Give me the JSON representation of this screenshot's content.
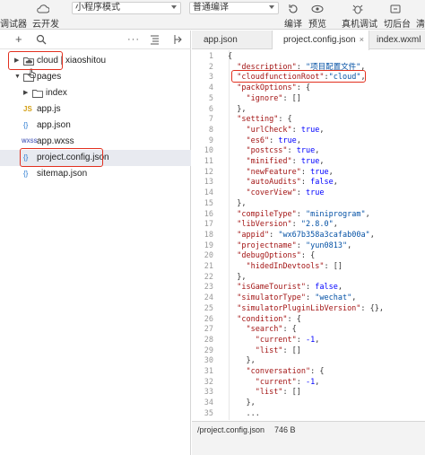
{
  "toolbar": {
    "debugger_label": "调试器",
    "cloud_dev_label": "云开发",
    "mode_select": "小程序模式",
    "compile_select": "普通编译",
    "compile_label": "编译",
    "preview_label": "预览",
    "remote_debug_label": "真机调试",
    "background_label": "切后台",
    "cut_label": "清"
  },
  "explorer": {
    "toolbar_icons": [
      "plus-icon",
      "search-icon",
      "more-icon",
      "collapse-icon",
      "split-icon"
    ],
    "items": [
      {
        "name": "cloud | xiaoshitou",
        "kind": "cloud-folder"
      },
      {
        "name": "pages",
        "kind": "folder"
      },
      {
        "name": "index",
        "kind": "folder"
      },
      {
        "name": "app.js",
        "kind": "js"
      },
      {
        "name": "app.json",
        "kind": "json"
      },
      {
        "name": "app.wxss",
        "kind": "wxss"
      },
      {
        "name": "project.config.json",
        "kind": "json"
      },
      {
        "name": "sitemap.json",
        "kind": "json"
      }
    ]
  },
  "tabs": [
    {
      "label": "app.json"
    },
    {
      "label": "project.config.json",
      "close": "×"
    },
    {
      "label": "index.wxml"
    }
  ],
  "code_lines": [
    {
      "n": "1",
      "text": "{"
    },
    {
      "n": "2",
      "text": "  \"description\": \"项目配置文件\","
    },
    {
      "n": "3",
      "text": "  \"cloudfunctionRoot\":\"cloud\","
    },
    {
      "n": "4",
      "text": "  \"packOptions\": {"
    },
    {
      "n": "5",
      "text": "    \"ignore\": []"
    },
    {
      "n": "6",
      "text": "  },"
    },
    {
      "n": "7",
      "text": "  \"setting\": {"
    },
    {
      "n": "8",
      "text": "    \"urlCheck\": true,"
    },
    {
      "n": "9",
      "text": "    \"es6\": true,"
    },
    {
      "n": "10",
      "text": "    \"postcss\": true,"
    },
    {
      "n": "11",
      "text": "    \"minified\": true,"
    },
    {
      "n": "12",
      "text": "    \"newFeature\": true,"
    },
    {
      "n": "13",
      "text": "    \"autoAudits\": false,"
    },
    {
      "n": "14",
      "text": "    \"coverView\": true"
    },
    {
      "n": "15",
      "text": "  },"
    },
    {
      "n": "16",
      "text": "  \"compileType\": \"miniprogram\","
    },
    {
      "n": "17",
      "text": "  \"libVersion\": \"2.8.0\","
    },
    {
      "n": "18",
      "text": "  \"appid\": \"wx67b358a3cafab00a\","
    },
    {
      "n": "19",
      "text": "  \"projectname\": \"yun0813\","
    },
    {
      "n": "20",
      "text": "  \"debugOptions\": {"
    },
    {
      "n": "21",
      "text": "    \"hidedInDevtools\": []"
    },
    {
      "n": "22",
      "text": "  },"
    },
    {
      "n": "23",
      "text": "  \"isGameTourist\": false,"
    },
    {
      "n": "24",
      "text": "  \"simulatorType\": \"wechat\","
    },
    {
      "n": "25",
      "text": "  \"simulatorPluginLibVersion\": {},"
    },
    {
      "n": "26",
      "text": "  \"condition\": {"
    },
    {
      "n": "27",
      "text": "    \"search\": {"
    },
    {
      "n": "28",
      "text": "      \"current\": -1,"
    },
    {
      "n": "29",
      "text": "      \"list\": []"
    },
    {
      "n": "30",
      "text": "    },"
    },
    {
      "n": "31",
      "text": "    \"conversation\": {"
    },
    {
      "n": "32",
      "text": "      \"current\": -1,"
    },
    {
      "n": "33",
      "text": "      \"list\": []"
    },
    {
      "n": "34",
      "text": "    },"
    },
    {
      "n": "35",
      "text": "    ..."
    }
  ],
  "status": {
    "path": "/project.config.json",
    "size": "746 B"
  },
  "colors": {
    "highlight_box": "#e2301f",
    "json_key": "#a31515",
    "json_string": "#0451a5",
    "json_literal": "#0000ff"
  }
}
